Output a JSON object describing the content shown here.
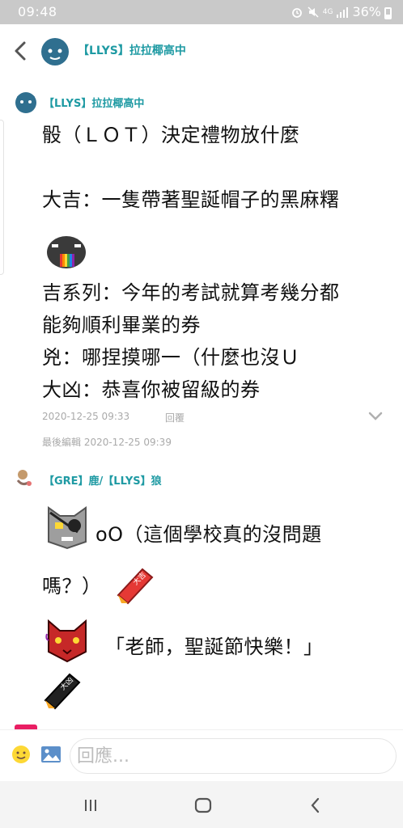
{
  "status_bar": {
    "time": "09:48",
    "network": "4G",
    "battery": "36%",
    "icons": [
      "alarm-icon",
      "mute-icon",
      "signal-icon",
      "battery-icon"
    ]
  },
  "header": {
    "title": "【LLYS】拉拉椰高中",
    "icons": [
      "back-arrow-icon",
      "avatar"
    ]
  },
  "post1": {
    "author": "【LLYS】拉拉椰高中",
    "lines": [
      "骰（ＬＯＴ）決定禮物放什麼",
      "大吉：一隻帶著聖誕帽子的黑麻糬",
      "吉系列：今年的考試就算考幾分都",
      "能夠順利畢業的券",
      "兇：哪捏摸哪一（什麼也沒Ｕ",
      "大凶：恭喜你被留級的券"
    ],
    "timestamp": "2020-12-25 09:33",
    "reply_label": "回覆",
    "edited": "最後編輯 2020-12-25 09:39"
  },
  "post2": {
    "author": "【GRE】鹿/【LLYS】狼",
    "line1": "oO（這個學校真的沒問題",
    "line2": "嗎？）",
    "line3": "「老師，聖誕節快樂！」"
  },
  "composer": {
    "placeholder": "回應..."
  },
  "colors": {
    "accent": "#1e9aa3",
    "status_bar": "#c9c9c9",
    "meta_text": "#aaaaaa"
  }
}
